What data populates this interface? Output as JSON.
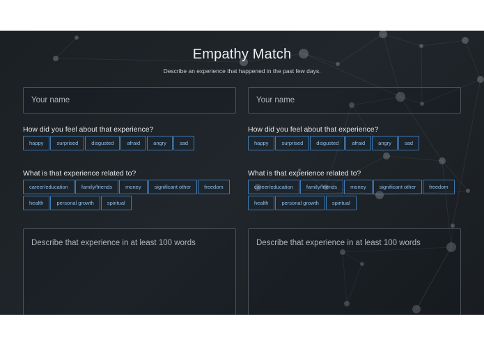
{
  "header": {
    "title": "Empathy Match",
    "subtitle": "Describe an experience that happened in the past few days."
  },
  "form_left": {
    "name_placeholder": "Your name",
    "feel_question": "How did you feel about that experience?",
    "feelings": [
      "happy",
      "surprised",
      "disgusted",
      "afraid",
      "angry",
      "sad"
    ],
    "related_question": "What is that experience related to?",
    "topics": [
      "career/education",
      "family/friends",
      "money",
      "significant other",
      "freedom",
      "health",
      "personal growth",
      "spiritual"
    ],
    "description_placeholder": "Describe that experience in at least 100 words"
  },
  "form_right": {
    "name_placeholder": "Your name",
    "feel_question": "How did you feel about that experience?",
    "feelings": [
      "happy",
      "surprised",
      "disgusted",
      "afraid",
      "angry",
      "sad"
    ],
    "related_question": "What is that experience related to?",
    "topics": [
      "career/education",
      "family/friends",
      "money",
      "significant other",
      "freedom",
      "health",
      "personal growth",
      "spiritual"
    ],
    "description_placeholder": "Describe that experience in at least 100 words"
  },
  "colors": {
    "background": "#1d2226",
    "chip_border": "#3d7bb7",
    "chip_text": "#8fbde8",
    "text": "#e8eaec"
  }
}
